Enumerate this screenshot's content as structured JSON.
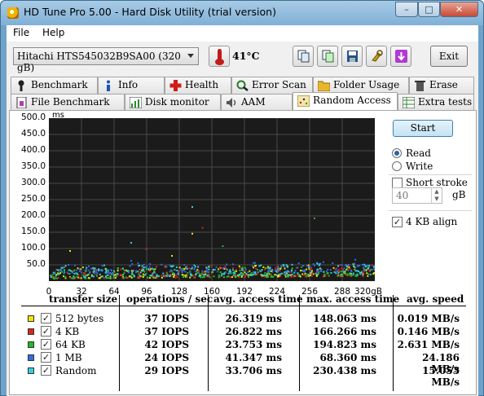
{
  "window": {
    "title": "HD Tune Pro 5.00 - Hard Disk Utility (trial version)",
    "controls": {
      "minimize": "–",
      "maximize": "□",
      "close": "✕"
    }
  },
  "menu": {
    "file": "File",
    "help": "Help"
  },
  "toolbar": {
    "drive": "Hitachi HTS545032B9SA00  (320 gB)",
    "temperature": "41",
    "temperature_unit": "°C",
    "exit_label": "Exit",
    "icon_buttons": [
      "copy-icon",
      "copy-info-icon",
      "save-icon",
      "options-icon",
      "download-icon"
    ]
  },
  "tabs_row1": [
    "Benchmark",
    "Info",
    "Health",
    "Error Scan",
    "Folder Usage",
    "Erase"
  ],
  "tabs_row2": [
    "File Benchmark",
    "Disk monitor",
    "AAM",
    "Random Access",
    "Extra tests"
  ],
  "active_tab": "Random Access",
  "controls": {
    "start_label": "Start",
    "read_label": "Read",
    "write_label": "Write",
    "mode": "Read",
    "short_stroke_label": "Short stroke",
    "short_stroke_checked": false,
    "short_stroke_value": "40",
    "short_stroke_unit": "gB",
    "align_label": "4 KB align",
    "align_checked": true
  },
  "chart_data": {
    "type": "scatter",
    "ylabel": "ms",
    "y_ticks": [
      "500.0",
      "450.0",
      "400.0",
      "350.0",
      "300.0",
      "250.0",
      "200.0",
      "150.0",
      "100.0",
      "50.0"
    ],
    "x_ticks": [
      "0",
      "32",
      "64",
      "96",
      "128",
      "160",
      "192",
      "224",
      "256",
      "288",
      "320gB"
    ],
    "xlim": [
      0,
      320
    ],
    "ylim": [
      0,
      500
    ],
    "grid": true,
    "background": "#1b1b1b",
    "series": [
      {
        "name": "512 bytes",
        "color": "#f2e600",
        "typical_ms": [
          10,
          45
        ],
        "outliers": [
          [
            140,
            148
          ],
          [
            120,
            80
          ],
          [
            20,
            95
          ]
        ]
      },
      {
        "name": "4 KB",
        "color": "#d6261e",
        "typical_ms": [
          10,
          45
        ],
        "outliers": [
          [
            150,
            166
          ],
          [
            95,
            100
          ]
        ]
      },
      {
        "name": "64 KB",
        "color": "#21b82a",
        "typical_ms": [
          10,
          42
        ],
        "outliers": [
          [
            260,
            195
          ],
          [
            170,
            110
          ]
        ]
      },
      {
        "name": "1 MB",
        "color": "#2f6ee0",
        "typical_ms": [
          25,
          55
        ],
        "outliers": [
          [
            300,
            68
          ],
          [
            80,
            65
          ]
        ]
      },
      {
        "name": "Random",
        "color": "#2fd3e0",
        "typical_ms": [
          15,
          50
        ],
        "outliers": [
          [
            140,
            230
          ],
          [
            80,
            120
          ]
        ]
      }
    ]
  },
  "table": {
    "headers": [
      "transfer size",
      "operations / sec",
      "avg. access time",
      "max. access time",
      "avg. speed"
    ],
    "rows": [
      {
        "label": "512 bytes",
        "color": "#f2e600",
        "checked": true,
        "ops": "37 IOPS",
        "avg": "26.319 ms",
        "max": "148.063 ms",
        "speed": "0.019 MB/s"
      },
      {
        "label": "4 KB",
        "color": "#d6261e",
        "checked": true,
        "ops": "37 IOPS",
        "avg": "26.822 ms",
        "max": "166.266 ms",
        "speed": "0.146 MB/s"
      },
      {
        "label": "64 KB",
        "color": "#21b82a",
        "checked": true,
        "ops": "42 IOPS",
        "avg": "23.753 ms",
        "max": "194.823 ms",
        "speed": "2.631 MB/s"
      },
      {
        "label": "1 MB",
        "color": "#2f6ee0",
        "checked": true,
        "ops": "24 IOPS",
        "avg": "41.347 ms",
        "max": "68.360 ms",
        "speed": "24.186 MB/s"
      },
      {
        "label": "Random",
        "color": "#2fd3e0",
        "checked": true,
        "ops": "29 IOPS",
        "avg": "33.706 ms",
        "max": "230.438 ms",
        "speed": "15.053 MB/s"
      }
    ]
  }
}
